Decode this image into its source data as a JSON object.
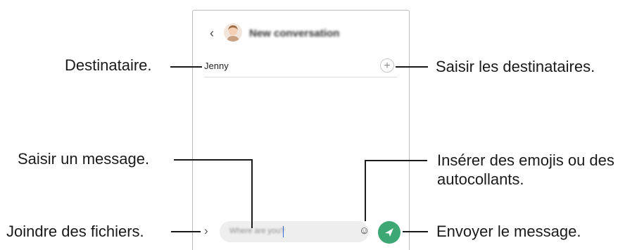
{
  "phone": {
    "header": {
      "back_icon": "chevron-left-icon",
      "title": "New conversation"
    },
    "recipient": {
      "name": "Jenny",
      "add_icon": "plus-icon"
    },
    "composer": {
      "attach_icon": "chevron-right-icon",
      "placeholder": "Where are you?",
      "emoji_icon": "smiley-icon",
      "send_icon": "send-icon",
      "send_color": "#3ea874"
    }
  },
  "callouts": {
    "recipient": "Destinataire.",
    "add_recipients": "Saisir les destinataires.",
    "enter_message": "Saisir un message.",
    "emoji_line1": "Insérer des emojis ou des",
    "emoji_line2": "autocollants.",
    "attach_files": "Joindre des fichiers.",
    "send_message": "Envoyer le message."
  }
}
